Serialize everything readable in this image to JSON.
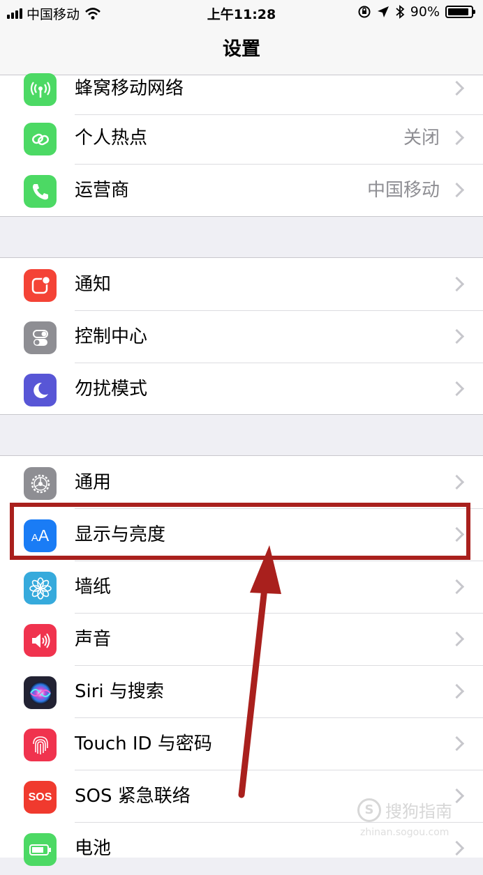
{
  "status_bar": {
    "carrier": "中国移动",
    "time": "上午11:28",
    "battery": "90%",
    "battery_level": 0.9
  },
  "nav": {
    "title": "设置"
  },
  "groups": [
    {
      "items": [
        {
          "label": "蜂窝移动网络",
          "value": "",
          "icon": "cellular-antenna-icon",
          "color": "#4cd964"
        },
        {
          "label": "个人热点",
          "value": "关闭",
          "icon": "hotspot-link-icon",
          "color": "#4cd964"
        },
        {
          "label": "运营商",
          "value": "中国移动",
          "icon": "phone-icon",
          "color": "#4cd964"
        }
      ]
    },
    {
      "items": [
        {
          "label": "通知",
          "value": "",
          "icon": "notification-icon",
          "color": "#f44336"
        },
        {
          "label": "控制中心",
          "value": "",
          "icon": "toggle-switches-icon",
          "color": "#8e8e93"
        },
        {
          "label": "勿扰模式",
          "value": "",
          "icon": "moon-icon",
          "color": "#5856d6"
        }
      ]
    },
    {
      "items": [
        {
          "label": "通用",
          "value": "",
          "icon": "gear-icon",
          "color": "#8e8e93"
        },
        {
          "label": "显示与亮度",
          "value": "",
          "icon": "text-size-aa-icon",
          "color": "#1a7cf5",
          "icon_text": "AA"
        },
        {
          "label": "墙纸",
          "value": "",
          "icon": "flower-icon",
          "color": "#36aadc"
        },
        {
          "label": "声音",
          "value": "",
          "icon": "speaker-icon",
          "color": "#f0334e"
        },
        {
          "label": "Siri 与搜索",
          "value": "",
          "icon": "siri-icon",
          "color": "#222233"
        },
        {
          "label": "Touch ID 与密码",
          "value": "",
          "icon": "fingerprint-icon",
          "color": "#f0334e"
        },
        {
          "label": "SOS 紧急联络",
          "value": "",
          "icon": "sos-icon",
          "color": "#f03a2e",
          "icon_text": "SOS"
        },
        {
          "label": "电池",
          "value": "",
          "icon": "battery-icon",
          "color": "#4cd964"
        }
      ]
    }
  ],
  "watermark": {
    "text": "搜狗指南",
    "url": "zhinan.sogou.com"
  },
  "annotation": {
    "highlight_color": "#a9201d"
  }
}
